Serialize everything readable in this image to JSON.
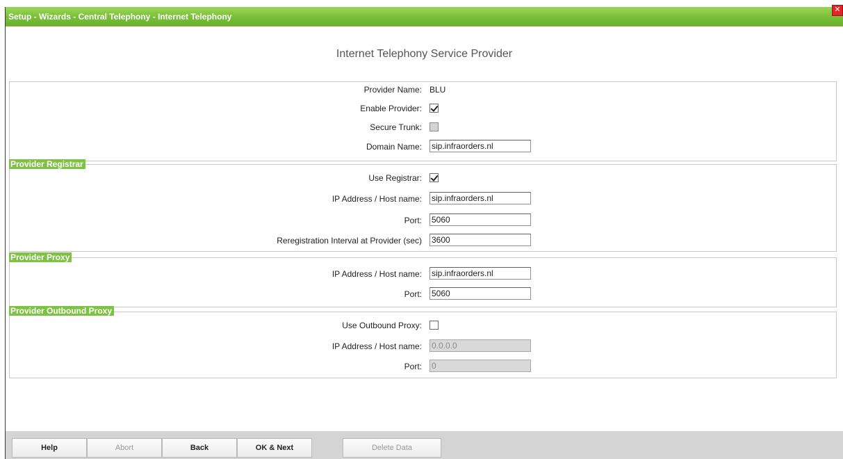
{
  "window": {
    "title": "Setup - Wizards - Central Telephony - Internet Telephony"
  },
  "page": {
    "title": "Internet Telephony Service Provider"
  },
  "general": {
    "provider_name_label": "Provider Name:",
    "provider_name_value": "BLU",
    "enable_provider_label": "Enable Provider:",
    "enable_provider_checked": true,
    "secure_trunk_label": "Secure Trunk:",
    "secure_trunk_checked": false,
    "domain_name_label": "Domain Name:",
    "domain_name_value": "sip.infraorders.nl"
  },
  "registrar": {
    "section_label": "Provider Registrar",
    "use_registrar_label": "Use Registrar:",
    "use_registrar_checked": true,
    "host_label": "IP Address / Host name:",
    "host_value": "sip.infraorders.nl",
    "port_label": "Port:",
    "port_value": "5060",
    "interval_label": "Reregistration Interval at Provider (sec)",
    "interval_value": "3600"
  },
  "proxy": {
    "section_label": "Provider Proxy",
    "host_label": "IP Address / Host name:",
    "host_value": "sip.infraorders.nl",
    "port_label": "Port:",
    "port_value": "5060"
  },
  "outbound_proxy": {
    "section_label": "Provider Outbound Proxy",
    "use_outbound_label": "Use Outbound Proxy:",
    "use_outbound_checked": false,
    "host_label": "IP Address / Host name:",
    "host_value": "0.0.0.0",
    "port_label": "Port:",
    "port_value": "0"
  },
  "footer": {
    "help": "Help",
    "abort": "Abort",
    "back": "Back",
    "ok_next": "OK & Next",
    "delete_data": "Delete Data"
  },
  "colors": {
    "accent": "#7dc242",
    "close": "#e0242a"
  },
  "icons": {
    "close": "close-icon"
  }
}
